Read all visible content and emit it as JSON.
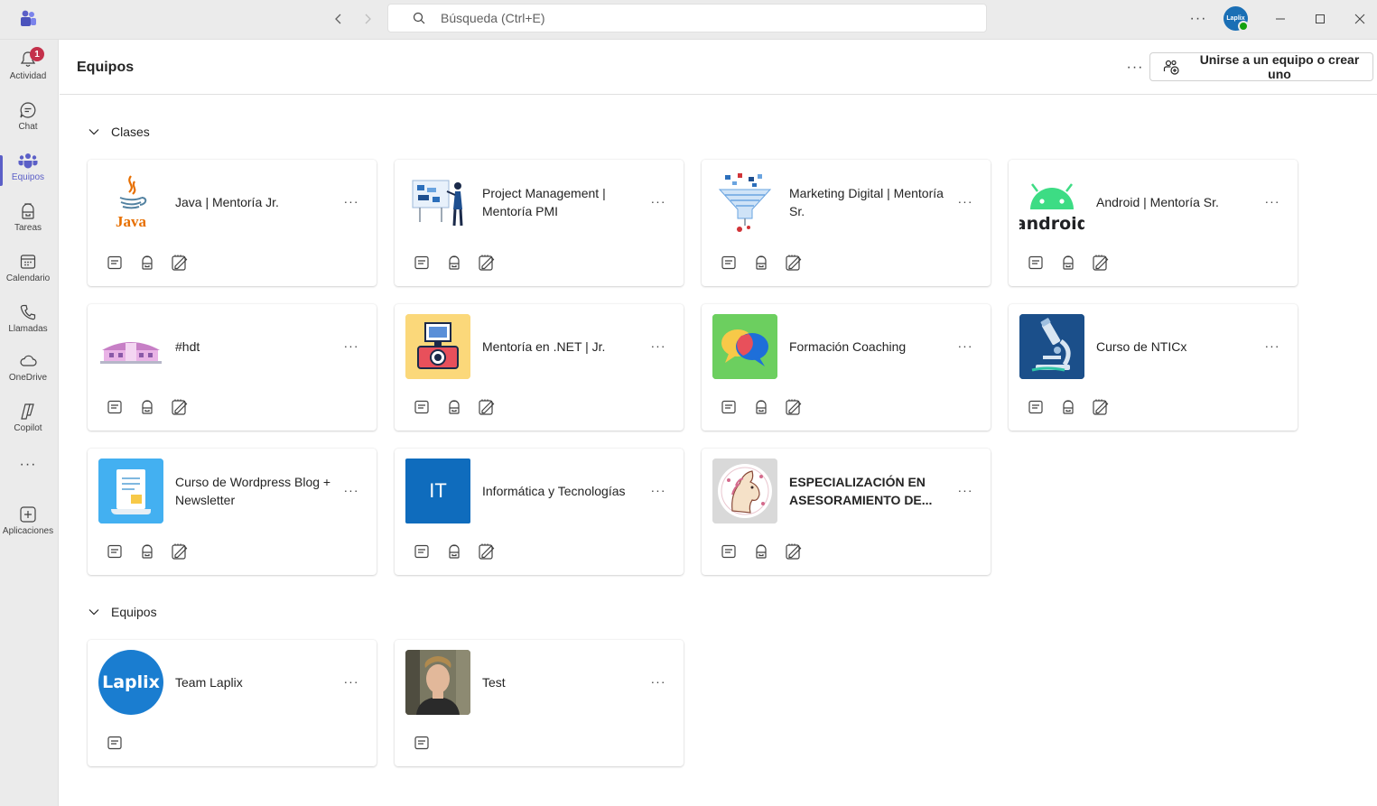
{
  "search": {
    "placeholder": "Búsqueda (Ctrl+E)"
  },
  "titlebar": {
    "more_label": "···",
    "avatar_text": "Laplix"
  },
  "rail": {
    "activity": {
      "label": "Actividad",
      "badge": "1"
    },
    "chat": {
      "label": "Chat"
    },
    "teams": {
      "label": "Equipos"
    },
    "tasks": {
      "label": "Tareas"
    },
    "calendar": {
      "label": "Calendario"
    },
    "calls": {
      "label": "Llamadas"
    },
    "onedrive": {
      "label": "OneDrive"
    },
    "copilot": {
      "label": "Copilot"
    },
    "more": "···",
    "apps": {
      "label": "Aplicaciones"
    }
  },
  "header": {
    "title": "Equipos",
    "more_label": "···",
    "join_button": "Unirse a un equipo o crear uno"
  },
  "sections": {
    "classes": {
      "title": "Clases",
      "cards": [
        {
          "name": "Java | Mentoría Jr.",
          "thumb": "java-logo",
          "more": "···"
        },
        {
          "name": "Project Management | Mentoría PMI",
          "thumb": "presentation-illustration",
          "more": "···"
        },
        {
          "name": "Marketing Digital | Mentoría Sr.",
          "thumb": "funnel-illustration",
          "more": "···"
        },
        {
          "name": "Android | Mentoría Sr.",
          "thumb": "android-logo",
          "thumb_text": "android",
          "more": "···"
        },
        {
          "name": "#hdt",
          "thumb": "building-illustration",
          "more": "···"
        },
        {
          "name": "Mentoría en .NET | Jr.",
          "thumb": "camera-illustration",
          "more": "···"
        },
        {
          "name": "Formación Coaching",
          "thumb": "chat-bubbles-illustration",
          "more": "···"
        },
        {
          "name": "Curso de NTICx",
          "thumb": "microscope-illustration",
          "more": "···"
        },
        {
          "name": "Curso de Wordpress Blog + Newsletter",
          "thumb": "document-illustration",
          "more": "···"
        },
        {
          "name": "Informática y Tecnologías",
          "thumb": "it-tile",
          "thumb_text": "IT",
          "more": "···"
        },
        {
          "name": "ESPECIALIZACIÓN EN ASESORAMIENTO DE...",
          "thumb": "horse-seal",
          "more": "···"
        }
      ]
    },
    "teams": {
      "title": "Equipos",
      "cards": [
        {
          "name": "Team Laplix",
          "thumb": "laplix-logo",
          "thumb_text": "Laplix",
          "more": "···"
        },
        {
          "name": "Test",
          "thumb": "person-photo",
          "more": "···"
        }
      ]
    }
  },
  "colors": {
    "accent": "#5b5fc7",
    "badge": "#c4314b",
    "presence": "#13a10e",
    "rail_bg": "#ebebeb"
  }
}
